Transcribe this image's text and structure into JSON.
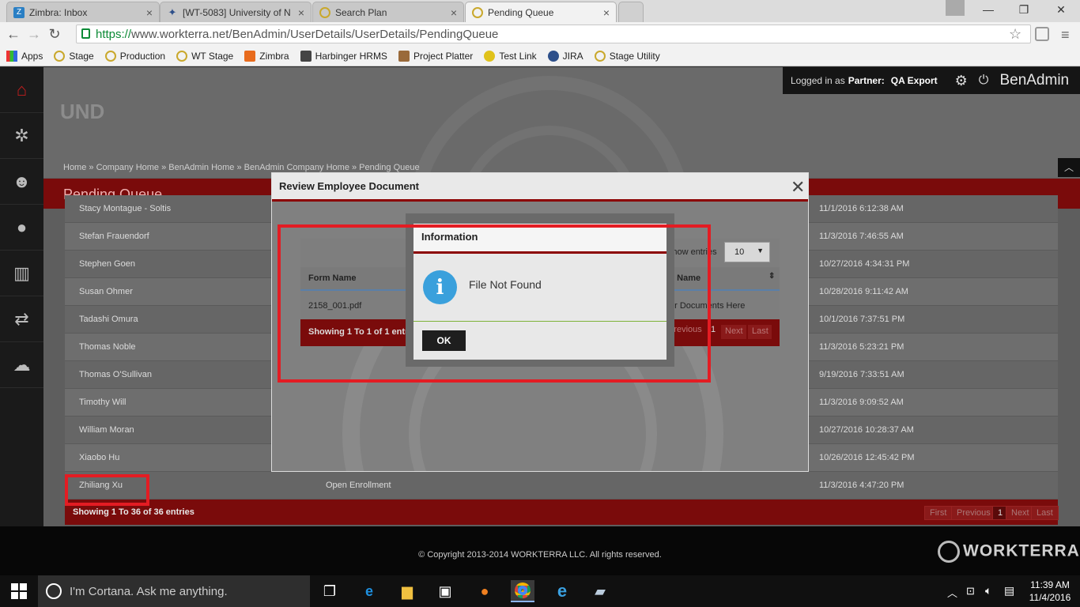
{
  "browser": {
    "tabs": [
      {
        "title": "Zimbra: Inbox",
        "icon": "zimbra-icon"
      },
      {
        "title": "[WT-5083] University of N",
        "icon": "jira-icon"
      },
      {
        "title": "Search Plan",
        "icon": "workterra-icon"
      },
      {
        "title": "Pending Queue",
        "icon": "workterra-icon",
        "active": true
      }
    ],
    "url_scheme": "https://",
    "url_rest": "www.workterra.net/BenAdmin/UserDetails/UserDetails/PendingQueue",
    "bookmarks": [
      "Apps",
      "Stage",
      "Production",
      "WT Stage",
      "Zimbra",
      "Harbinger HRMS",
      "Project Platter",
      "Test Link",
      "JIRA",
      "Stage Utility"
    ]
  },
  "app": {
    "org_name": "UND",
    "logged_in_prefix": "Logged in as",
    "logged_in_role": "Partner:",
    "logged_in_user": "QA Export",
    "app_name": "BenAdmin",
    "breadcrumb": "Home  »  Company Home  »  BenAdmin Home  »  BenAdmin Company Home  »  Pending Queue",
    "page_title": "Pending Queue",
    "rows": [
      {
        "name": "Stacy Montague - Soltis",
        "type": "",
        "date": "11/1/2016 6:12:38 AM"
      },
      {
        "name": "Stefan Frauendorf",
        "type": "",
        "date": "11/3/2016 7:46:55 AM"
      },
      {
        "name": "Stephen Goen",
        "type": "",
        "date": "10/27/2016 4:34:31 PM"
      },
      {
        "name": "Susan Ohmer",
        "type": "",
        "date": "10/28/2016 9:11:42 AM"
      },
      {
        "name": "Tadashi Omura",
        "type": "",
        "date": "10/1/2016 7:37:51 PM"
      },
      {
        "name": "Thomas Noble",
        "type": "",
        "date": "11/3/2016 5:23:21 PM"
      },
      {
        "name": "Thomas O'Sullivan",
        "type": "",
        "date": "9/19/2016 7:33:51 AM"
      },
      {
        "name": "Timothy Will",
        "type": "",
        "date": "11/3/2016 9:09:52 AM"
      },
      {
        "name": "William Moran",
        "type": "",
        "date": "10/27/2016 10:28:37 AM"
      },
      {
        "name": "Xiaobo Hu",
        "type": "",
        "date": "10/26/2016 12:45:42 PM"
      },
      {
        "name": "Zhiliang Xu",
        "type": "Open Enrollment",
        "date": "11/3/2016 4:47:20 PM"
      }
    ],
    "showing_text": "Showing 1 To 36 of 36 entries",
    "pager": {
      "first": "First",
      "previous": "Previous",
      "page": "1",
      "next": "Next",
      "last": "Last"
    },
    "copyright": "© Copyright 2013-2014 WORKTERRA LLC. All rights reserved.",
    "logo_text": "WORKTERRA"
  },
  "review_modal": {
    "title": "Review Employee Document",
    "show_entries_label": "Show entries",
    "show_entries_value": "10",
    "col_form_name": "Form Name",
    "col_right": "y Name",
    "file_name": "2158_001.pdf",
    "right_cell": "ur Documents Here",
    "showing_text": "Showing 1 To 1 of 1 entries",
    "pager": {
      "previous": "Previous",
      "page": "1",
      "next": "Next",
      "last": "Last"
    }
  },
  "info_dialog": {
    "title": "Information",
    "message": "File Not Found",
    "ok_label": "OK"
  },
  "taskbar": {
    "cortana_placeholder": "I'm Cortana. Ask me anything.",
    "time": "11:39 AM",
    "date": "11/4/2016"
  }
}
